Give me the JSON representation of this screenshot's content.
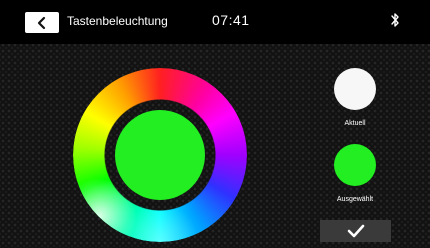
{
  "header": {
    "title": "Tastenbeleuchtung",
    "time": "07:41",
    "back_icon": "chevron-left-icon",
    "status_icon": "bluetooth-icon"
  },
  "color_picker": {
    "preview_color": "#22ee22"
  },
  "swatches": {
    "current": {
      "label": "Aktuell",
      "color": "#f7f7f7"
    },
    "selected": {
      "label": "Ausgewählt",
      "color": "#22ee22"
    }
  },
  "confirm": {
    "icon": "checkmark-icon"
  }
}
